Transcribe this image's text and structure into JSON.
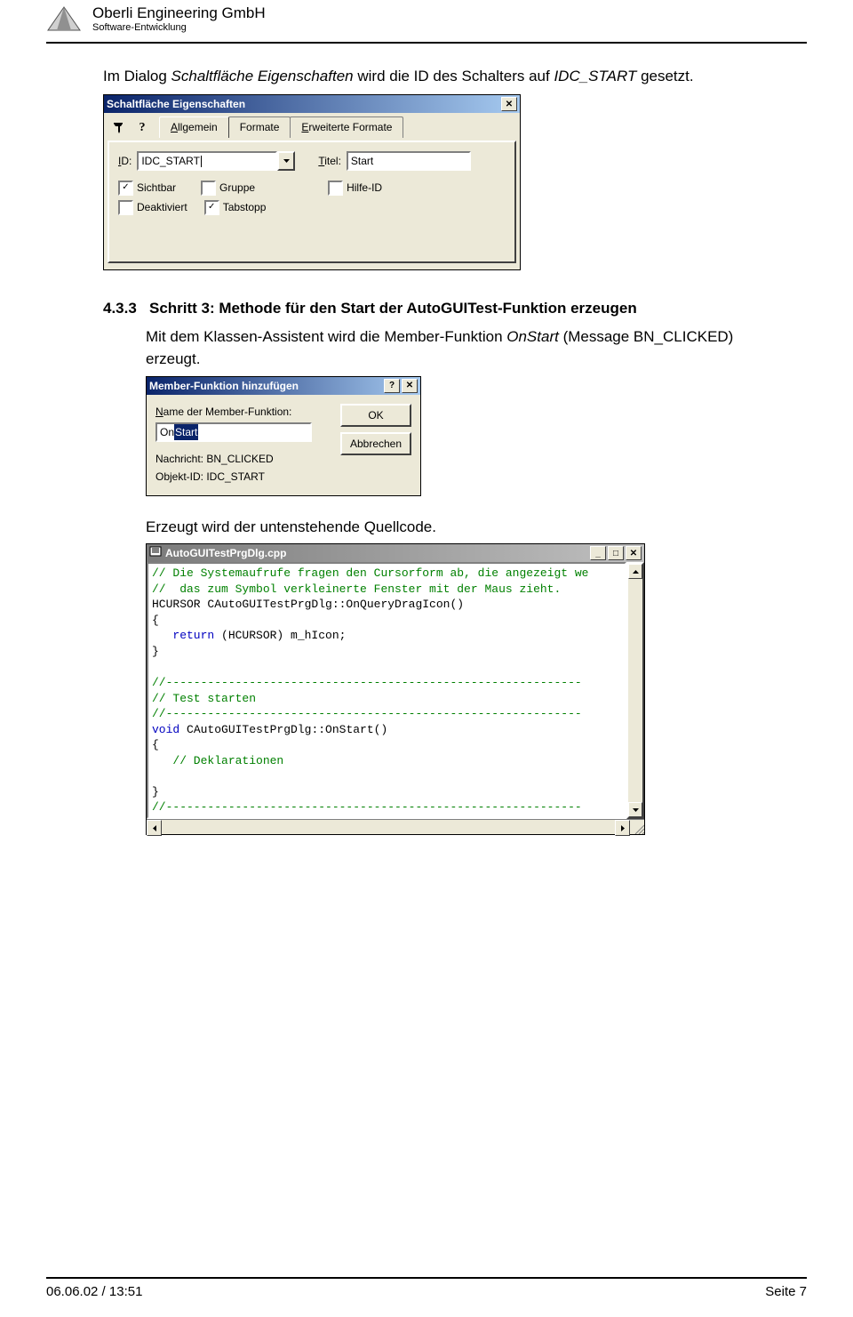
{
  "header": {
    "company": "Oberli Engineering GmbH",
    "dept": "Software-Entwicklung"
  },
  "intro": {
    "pre": "Im Dialog ",
    "dlgname": "Schaltfläche Eigenschaften",
    "mid": " wird die ID des Schalters auf ",
    "idc": "IDC_START",
    "post": " gesetzt."
  },
  "dlg1": {
    "title": "Schaltfläche Eigenschaften",
    "tabs": {
      "general": "llgemein",
      "formats": "Formate",
      "ext": "rweiterte Formate"
    },
    "id_label": "D:",
    "id_value": "IDC_START",
    "titel_label": "itel:",
    "titel_value": "Start",
    "chk": {
      "sichtbar": "ichtbar",
      "gruppe": "ruppe",
      "hilfe": "ilfe-ID",
      "deakt": "eaktiviert",
      "tab": "abstopp"
    },
    "state": {
      "sichtbar": "✓",
      "tab": "✓"
    }
  },
  "section": {
    "num": "4.3.3",
    "title": "Schritt 3: Methode für den Start der AutoGUITest-Funktion erzeugen",
    "body_pre": "Mit dem Klassen-Assistent wird die Member-Funktion ",
    "body_em": "OnStart",
    "body_mid": " (Message BN_CLICKED)",
    "body_post2": "erzeugt."
  },
  "dlg2": {
    "title": "Member-Funktion hinzufügen",
    "name_label": "ame der Member-Funktion:",
    "val_pre": "On",
    "val_sel": "Start",
    "nachricht": "Nachricht: BN_CLICKED",
    "objekt": "Objekt-ID: IDC_START",
    "ok": "OK",
    "cancel": "Abbrechen"
  },
  "p3": "Erzeugt wird der untenstehende Quellcode.",
  "codewin": {
    "title": "AutoGUITestPrgDlg.cpp",
    "lines": {
      "c1": "// Die Systemaufrufe fragen den Cursorform ab, die angezeigt we",
      "c2": "//  das zum Symbol verkleinerte Fenster mit der Maus zieht.",
      "l3a": "HCURSOR",
      "l3b": " CAutoGUITestPrgDlg::OnQueryDragIcon()",
      "l4": "{",
      "l5a": "   ",
      "l5b": "return",
      "l5c": " (HCURSOR) m_hIcon;",
      "l6": "}",
      "l7": "",
      "c8": "//------------------------------------------------------------",
      "c9": "// Test starten",
      "c10": "//------------------------------------------------------------",
      "l11a": "void",
      "l11b": " CAutoGUITestPrgDlg::OnStart()",
      "l12": "{",
      "c13": "   // Deklarationen",
      "l14": "",
      "l15": "}",
      "c16": "//------------------------------------------------------------"
    }
  },
  "footer": {
    "left": "06.06.02 / 13:51",
    "right": "Seite 7"
  }
}
